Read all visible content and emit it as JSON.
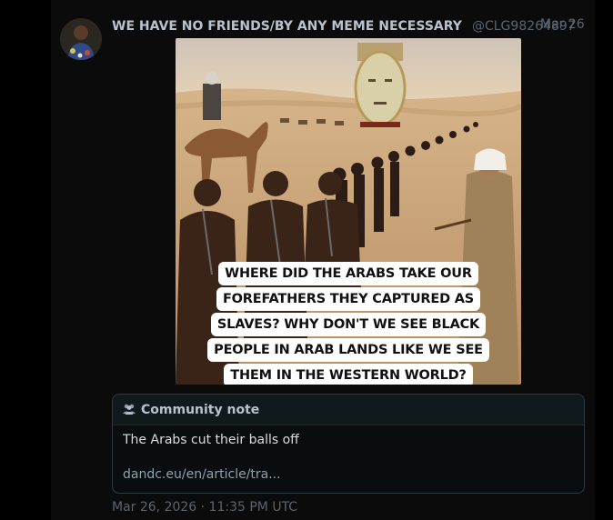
{
  "post": {
    "author": "WE HAVE NO FRIENDS/BY ANY MEME NECESSARY",
    "handle": "@CLG98264897",
    "date": "Mar 26",
    "image_caption_lines": [
      "WHERE DID THE ARABS TAKE OUR",
      "FOREFATHERS THEY CAPTURED AS",
      "SLAVES? WHY DON'T WE SEE BLACK",
      "PEOPLE IN ARAB LANDS LIKE WE SEE",
      "THEM IN THE WESTERN WORLD?"
    ],
    "timestamp": "Mar 26, 2026 · 11:35 PM UTC"
  },
  "community_note": {
    "icon": "people-icon",
    "title": "Community note",
    "text": "The Arabs cut their balls off",
    "link": "dandc.eu/en/article/tra..."
  },
  "colors": {
    "background": "#000000",
    "text_muted": "#5a6470",
    "author": "#b9c2cc",
    "note_header": "#10191c"
  }
}
